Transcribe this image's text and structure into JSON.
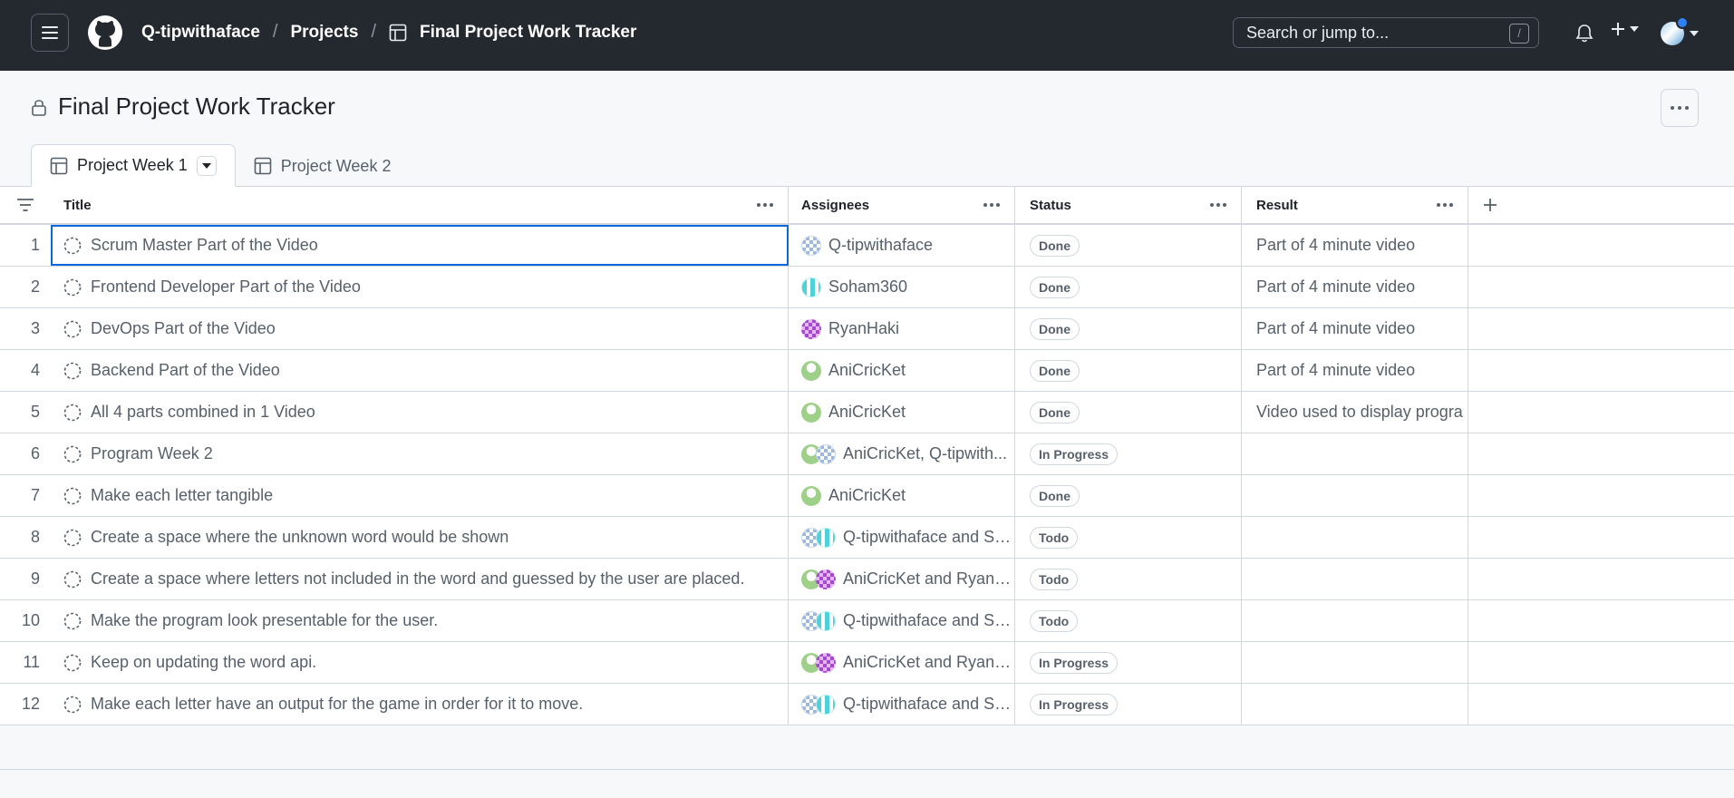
{
  "header": {
    "user": "Q-tipwithaface",
    "projects_label": "Projects",
    "project_name": "Final Project Work Tracker",
    "search_placeholder": "Search or jump to...",
    "search_shortcut": "/"
  },
  "project": {
    "title": "Final Project Work Tracker"
  },
  "tabs": [
    {
      "label": "Project Week 1",
      "active": true
    },
    {
      "label": "Project Week 2",
      "active": false
    }
  ],
  "columns": {
    "title": "Title",
    "assignees": "Assignees",
    "status": "Status",
    "result": "Result"
  },
  "rows": [
    {
      "num": "1",
      "title": "Scrum Master Part of the Video",
      "assignees": "Q-tipwithaface",
      "status": "Done",
      "result": "Part of 4 minute video"
    },
    {
      "num": "2",
      "title": "Frontend Developer Part of the Video",
      "assignees": "Soham360",
      "status": "Done",
      "result": "Part of 4 minute video"
    },
    {
      "num": "3",
      "title": "DevOps Part of the Video",
      "assignees": "RyanHaki",
      "status": "Done",
      "result": "Part of 4 minute video"
    },
    {
      "num": "4",
      "title": "Backend Part of the Video",
      "assignees": "AniCricKet",
      "status": "Done",
      "result": "Part of 4 minute video"
    },
    {
      "num": "5",
      "title": "All 4 parts combined in 1 Video",
      "assignees": "AniCricKet",
      "status": "Done",
      "result": "Video used to display progra"
    },
    {
      "num": "6",
      "title": "Program Week 2",
      "assignees": "AniCricKet, Q-tipwith...",
      "status": "In Progress",
      "result": ""
    },
    {
      "num": "7",
      "title": "Make each letter tangible",
      "assignees": "AniCricKet",
      "status": "Done",
      "result": ""
    },
    {
      "num": "8",
      "title": "Create a space where the unknown word would be shown",
      "assignees": "Q-tipwithaface and So...",
      "status": "Todo",
      "result": ""
    },
    {
      "num": "9",
      "title": "Create a space where letters not included in the word and guessed by the user are placed.",
      "assignees": "AniCricKet and RyanH...",
      "status": "Todo",
      "result": ""
    },
    {
      "num": "10",
      "title": "Make the program look presentable for the user.",
      "assignees": "Q-tipwithaface and So...",
      "status": "Todo",
      "result": ""
    },
    {
      "num": "11",
      "title": "Keep on updating the word api.",
      "assignees": "AniCricKet and RyanH...",
      "status": "In Progress",
      "result": ""
    },
    {
      "num": "12",
      "title": "Make each letter have an output for the game in order for it to move.",
      "assignees": "Q-tipwithaface and So...",
      "status": "In Progress",
      "result": ""
    }
  ],
  "icons": {
    "menu": "hamburger-icon",
    "logo": "github-logo-icon",
    "table": "table-icon",
    "bell": "bell-icon",
    "plus": "plus-icon",
    "lock": "lock-icon",
    "filter": "filter-icon",
    "draft": "draft-issue-icon",
    "more": "kebab-icon"
  }
}
